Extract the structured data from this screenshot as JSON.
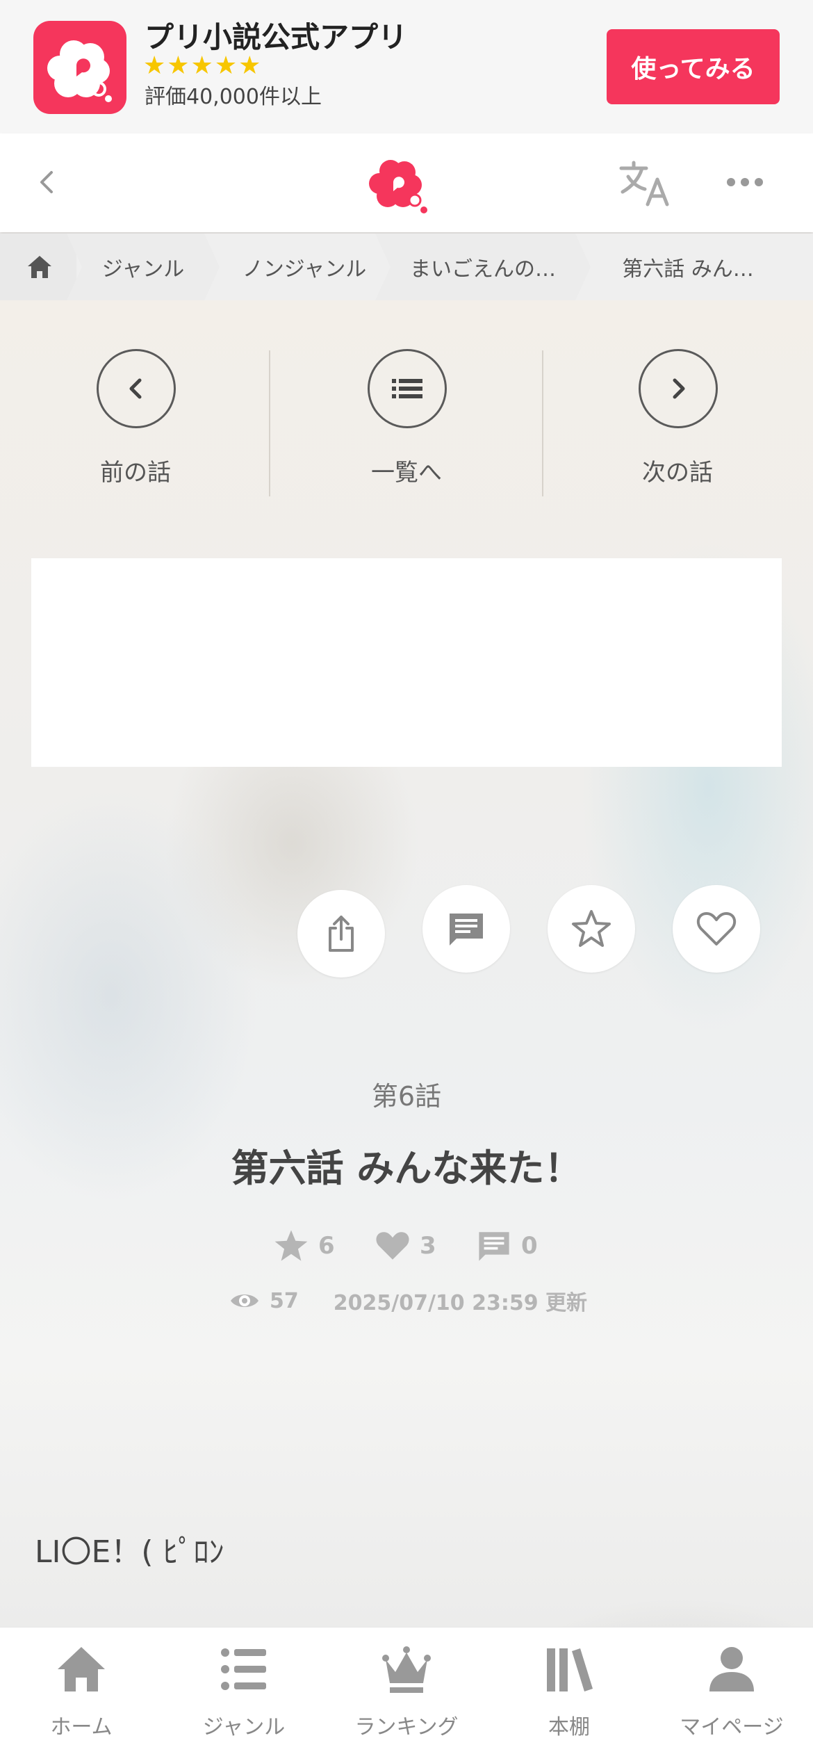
{
  "app_banner": {
    "app_name": "プリ小説公式アプリ",
    "stars": "★★★★★",
    "rating_text": "評価40,000件以上",
    "cta_label": "使ってみる"
  },
  "breadcrumb": [
    "ジャンル",
    "ノンジャンル",
    "まいごえんの…",
    "第六話 みん…"
  ],
  "chapter_nav": {
    "prev_label": "前の話",
    "list_label": "一覧へ",
    "next_label": "次の話"
  },
  "chapter": {
    "number_label": "第6話",
    "title": "第六話 みんな来た！",
    "stars": "6",
    "likes": "3",
    "comments": "0",
    "views": "57",
    "updated": "2025/07/10 23:59 更新"
  },
  "body_text": "LI〇E！( ﾋﾟﾛﾝ",
  "bottom_nav": {
    "home": "ホーム",
    "genre": "ジャンル",
    "ranking": "ランキング",
    "bookshelf": "本棚",
    "mypage": "マイページ"
  },
  "colors": {
    "brand": "#f5365c",
    "star_rating": "#f7c600",
    "icon_gray": "#b5b5b5"
  },
  "icons": [
    "app-logo-icon",
    "back-icon",
    "translate-icon",
    "more-icon",
    "home-icon",
    "chevron-left-icon",
    "list-icon",
    "chevron-right-icon",
    "share-icon",
    "comment-icon",
    "star-icon",
    "heart-icon",
    "eye-icon",
    "crown-icon",
    "bookshelf-icon",
    "person-icon"
  ]
}
